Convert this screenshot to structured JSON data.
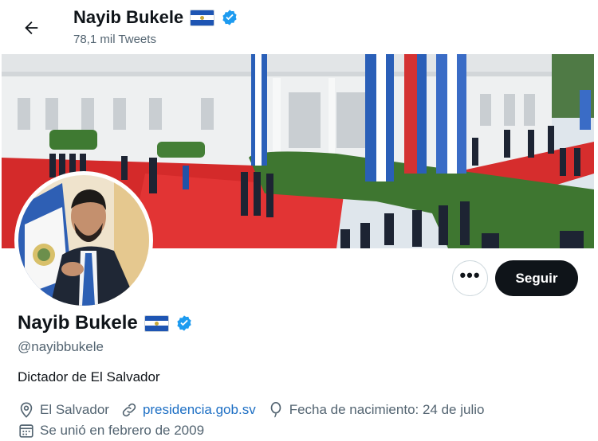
{
  "header": {
    "name": "Nayib Bukele",
    "tweet_count": "78,1 mil Tweets"
  },
  "profile": {
    "name": "Nayib Bukele",
    "handle": "@nayibbukele",
    "bio": "Dictador de El Salvador",
    "location": "El Salvador",
    "website": "presidencia.gob.sv",
    "birthday": "Fecha de nacimiento: 24 de julio",
    "joined": "Se unió en febrero de 2009"
  },
  "actions": {
    "more_label": "•••",
    "follow_label": "Seguir"
  },
  "icons": {
    "back": "arrow-left-icon",
    "verified": "verified-badge-icon",
    "flag": "el-salvador-flag-icon",
    "location": "location-pin-icon",
    "link": "link-icon",
    "birthday": "balloon-icon",
    "calendar": "calendar-icon"
  },
  "colors": {
    "accent": "#1d9bf0",
    "link": "#1d6fc4",
    "follow_button": "#0f1419",
    "secondary_text": "#536471"
  }
}
